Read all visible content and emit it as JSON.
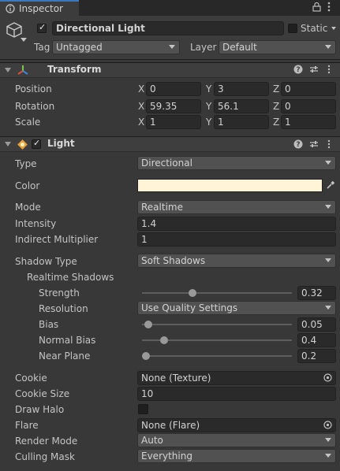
{
  "tab": {
    "label": "Inspector"
  },
  "header": {
    "name": "Directional Light",
    "static_label": "Static",
    "tag_label": "Tag",
    "tag_value": "Untagged",
    "layer_label": "Layer",
    "layer_value": "Default"
  },
  "transform": {
    "title": "Transform",
    "rows": [
      {
        "label": "Position",
        "x": "0",
        "y": "3",
        "z": "0"
      },
      {
        "label": "Rotation",
        "x": "59.35",
        "y": "56.1",
        "z": "0"
      },
      {
        "label": "Scale",
        "x": "1",
        "y": "1",
        "z": "1"
      }
    ],
    "axes": {
      "x": "X",
      "y": "Y",
      "z": "Z"
    }
  },
  "light": {
    "title": "Light",
    "type_label": "Type",
    "type_value": "Directional",
    "color_label": "Color",
    "color_value": "#fff4d6",
    "mode_label": "Mode",
    "mode_value": "Realtime",
    "intensity_label": "Intensity",
    "intensity_value": "1.4",
    "indirect_label": "Indirect Multiplier",
    "indirect_value": "1",
    "shadow_type_label": "Shadow Type",
    "shadow_type_value": "Soft Shadows",
    "realtime_shadows_label": "Realtime Shadows",
    "strength_label": "Strength",
    "strength_value": "0.32",
    "strength_fraction": 0.32,
    "resolution_label": "Resolution",
    "resolution_value": "Use Quality Settings",
    "bias_label": "Bias",
    "bias_value": "0.05",
    "bias_fraction": 0.025,
    "normal_bias_label": "Normal Bias",
    "normal_bias_value": "0.4",
    "normal_bias_fraction": 0.13,
    "near_plane_label": "Near Plane",
    "near_plane_value": "0.2",
    "near_plane_fraction": 0.01,
    "cookie_label": "Cookie",
    "cookie_value": "None (Texture)",
    "cookie_size_label": "Cookie Size",
    "cookie_size_value": "10",
    "draw_halo_label": "Draw Halo",
    "flare_label": "Flare",
    "flare_value": "None (Flare)",
    "render_mode_label": "Render Mode",
    "render_mode_value": "Auto",
    "culling_mask_label": "Culling Mask",
    "culling_mask_value": "Everything"
  },
  "icons": {
    "lock": "lock-icon",
    "menu": "kebab-menu-icon",
    "help": "help-icon",
    "preset": "preset-icon",
    "object_picker": "object-picker-icon",
    "eyedropper": "eyedropper-icon"
  },
  "colors": {
    "accent": "#3a79bb",
    "background": "#383838",
    "field": "#2a2a2a"
  }
}
